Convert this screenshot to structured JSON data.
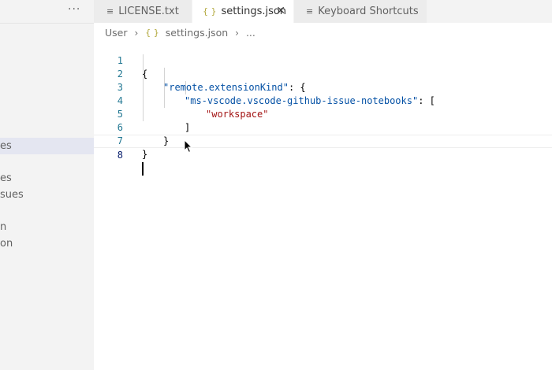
{
  "sidebar": {
    "more_label": "···",
    "items": [
      {
        "label": "es",
        "selected": true
      },
      {
        "label": "es",
        "selected": false
      },
      {
        "label": "sues",
        "selected": false
      },
      {
        "label": "n",
        "selected": false
      },
      {
        "label": "on",
        "selected": false
      }
    ]
  },
  "tabs": [
    {
      "label": "LICENSE.txt",
      "icon": "file-lines-icon",
      "active": false
    },
    {
      "label": "settings.json",
      "icon": "json-braces-icon",
      "active": true,
      "close": "✕"
    },
    {
      "label": "Keyboard Shortcuts",
      "icon": "file-lines-icon",
      "active": false
    }
  ],
  "breadcrumb": {
    "root": "User",
    "file": "settings.json",
    "more": "..."
  },
  "code": {
    "line_numbers": [
      "1",
      "2",
      "3",
      "4",
      "5",
      "6",
      "7",
      "8"
    ],
    "l1": "{",
    "l2_key": "\"remote.extensionKind\"",
    "l2_rest": ": {",
    "l3_key": "\"ms-vscode.vscode-github-issue-notebooks\"",
    "l3_rest": ": [",
    "l4_str": "\"workspace\"",
    "l5": "]",
    "l6": "}",
    "l7": "}",
    "current_line": "8"
  },
  "colors": {
    "json_key": "#0451a5",
    "json_string": "#a31515",
    "line_number": "#237893",
    "json_icon": "#b2a83c"
  }
}
